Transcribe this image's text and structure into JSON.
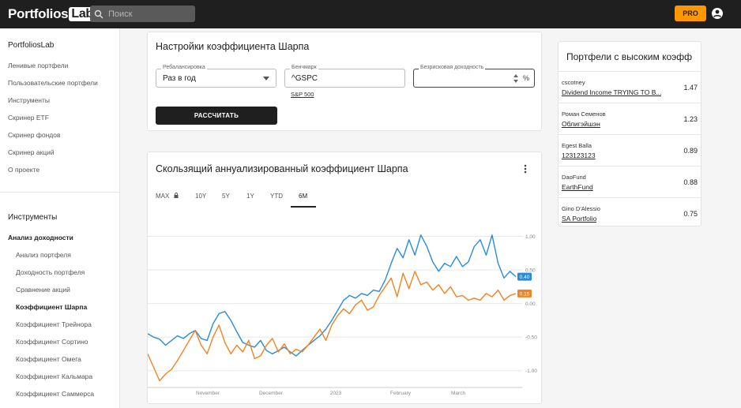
{
  "header": {
    "logo_main": "Portfolios",
    "logo_lab": "Lab",
    "search_placeholder": "Поиск",
    "pro_label": "PRO"
  },
  "sidebar": {
    "brand": "PortfoliosLab",
    "links": [
      "Ленивые портфели",
      "Пользовательские портфели",
      "Инструменты",
      "Скринер ETF",
      "Скринер фондов",
      "Скринер акций",
      "О проекте"
    ],
    "tools_title": "Инструменты",
    "section": "Анализ доходности",
    "sub_items": [
      "Анализ портфеля",
      "Доходность портфеля",
      "Сравнение акций",
      "Коэффициент Шарпа",
      "Коэффициент Трейнора",
      "Коэффициент Сортино",
      "Коэффициент Омега",
      "Коэффициент Кальмара",
      "Коэффициент Саммерса"
    ]
  },
  "settings": {
    "title": "Настройки коэффициента Шарпа",
    "rebalance_label": "Ребалансировка",
    "rebalance_value": "Раз в год",
    "benchmark_label": "Бенчмарк",
    "benchmark_value": "^GSPC",
    "benchmark_sub": "S&P 500",
    "riskfree_label": "Безрисковая доходность",
    "riskfree_unit": "%",
    "calc_button": "РАССЧИТАТЬ"
  },
  "chart_card": {
    "title": "Скользящий аннуализированный коэффициент Шарпа",
    "tabs": [
      "MAX",
      "10Y",
      "5Y",
      "1Y",
      "YTD",
      "6M"
    ],
    "active_tab": "6M"
  },
  "right_panel": {
    "title": "Портфели с высоким коэфф",
    "rows": [
      {
        "author": "cscotney",
        "name": "Dividend Income TRYING TO B...",
        "value": "1.47"
      },
      {
        "author": "Роман Семенов",
        "name": "Облигэйшэн",
        "value": "1.23"
      },
      {
        "author": "Egest Balla",
        "name": "123123123",
        "value": "0.89"
      },
      {
        "author": "DaoFund",
        "name": "EarthFund",
        "value": "0.88"
      },
      {
        "author": "Gino D'Alessio",
        "name": "SA Portfolio",
        "value": "0.75"
      }
    ]
  },
  "chart_data": {
    "type": "line",
    "title": "Скользящий аннуализированный коэффициент Шарпа",
    "x_tick_labels": [
      "November",
      "December",
      "2023",
      "February",
      "March"
    ],
    "y_tick_labels": [
      "1.00",
      "0.50",
      "0.00",
      "-0.50",
      "-1.00"
    ],
    "ylim": [
      -1.25,
      1.1
    ],
    "grid": true,
    "series": [
      {
        "color": "#2a8cd8",
        "last_label": "0.40",
        "values": [
          -0.45,
          -0.5,
          -0.53,
          -0.62,
          -0.55,
          -0.48,
          -0.52,
          -0.45,
          -0.4,
          -0.52,
          -0.55,
          -0.3,
          -0.15,
          -0.12,
          -0.25,
          -0.42,
          -0.58,
          -0.62,
          -0.65,
          -0.55,
          -0.7,
          -0.75,
          -0.7,
          -0.65,
          -0.72,
          -0.78,
          -0.7,
          -0.62,
          -0.55,
          -0.48,
          -0.38,
          -0.25,
          -0.1,
          0.05,
          0.12,
          0.08,
          0.15,
          0.12,
          0.2,
          0.18,
          0.35,
          0.6,
          0.82,
          0.68,
          0.95,
          0.72,
          1.02,
          0.85,
          0.62,
          0.48,
          0.6,
          0.55,
          0.7,
          0.55,
          0.62,
          0.85,
          0.95,
          0.72,
          1.02,
          0.6,
          0.38,
          0.48,
          0.4
        ]
      },
      {
        "color": "#f58220",
        "last_label": "0.15",
        "values": [
          -0.75,
          -0.95,
          -1.15,
          -1.05,
          -0.98,
          -0.85,
          -0.7,
          -0.55,
          -0.4,
          -0.62,
          -0.75,
          -0.5,
          -0.32,
          -0.58,
          -0.75,
          -0.62,
          -0.72,
          -0.55,
          -0.82,
          -0.78,
          -0.62,
          -0.52,
          -0.72,
          -0.6,
          -0.75,
          -0.68,
          -0.72,
          -0.62,
          -0.5,
          -0.38,
          -0.55,
          -0.32,
          -0.18,
          -0.08,
          -0.15,
          -0.02,
          0.05,
          -0.1,
          -0.05,
          0.12,
          0.25,
          0.38,
          0.1,
          0.45,
          0.22,
          0.48,
          0.28,
          0.32,
          0.2,
          0.28,
          0.15,
          0.25,
          0.1,
          0.12,
          0.05,
          0.08,
          0.05,
          0.15,
          0.1,
          0.2,
          0.05,
          0.12,
          0.15
        ]
      }
    ]
  }
}
